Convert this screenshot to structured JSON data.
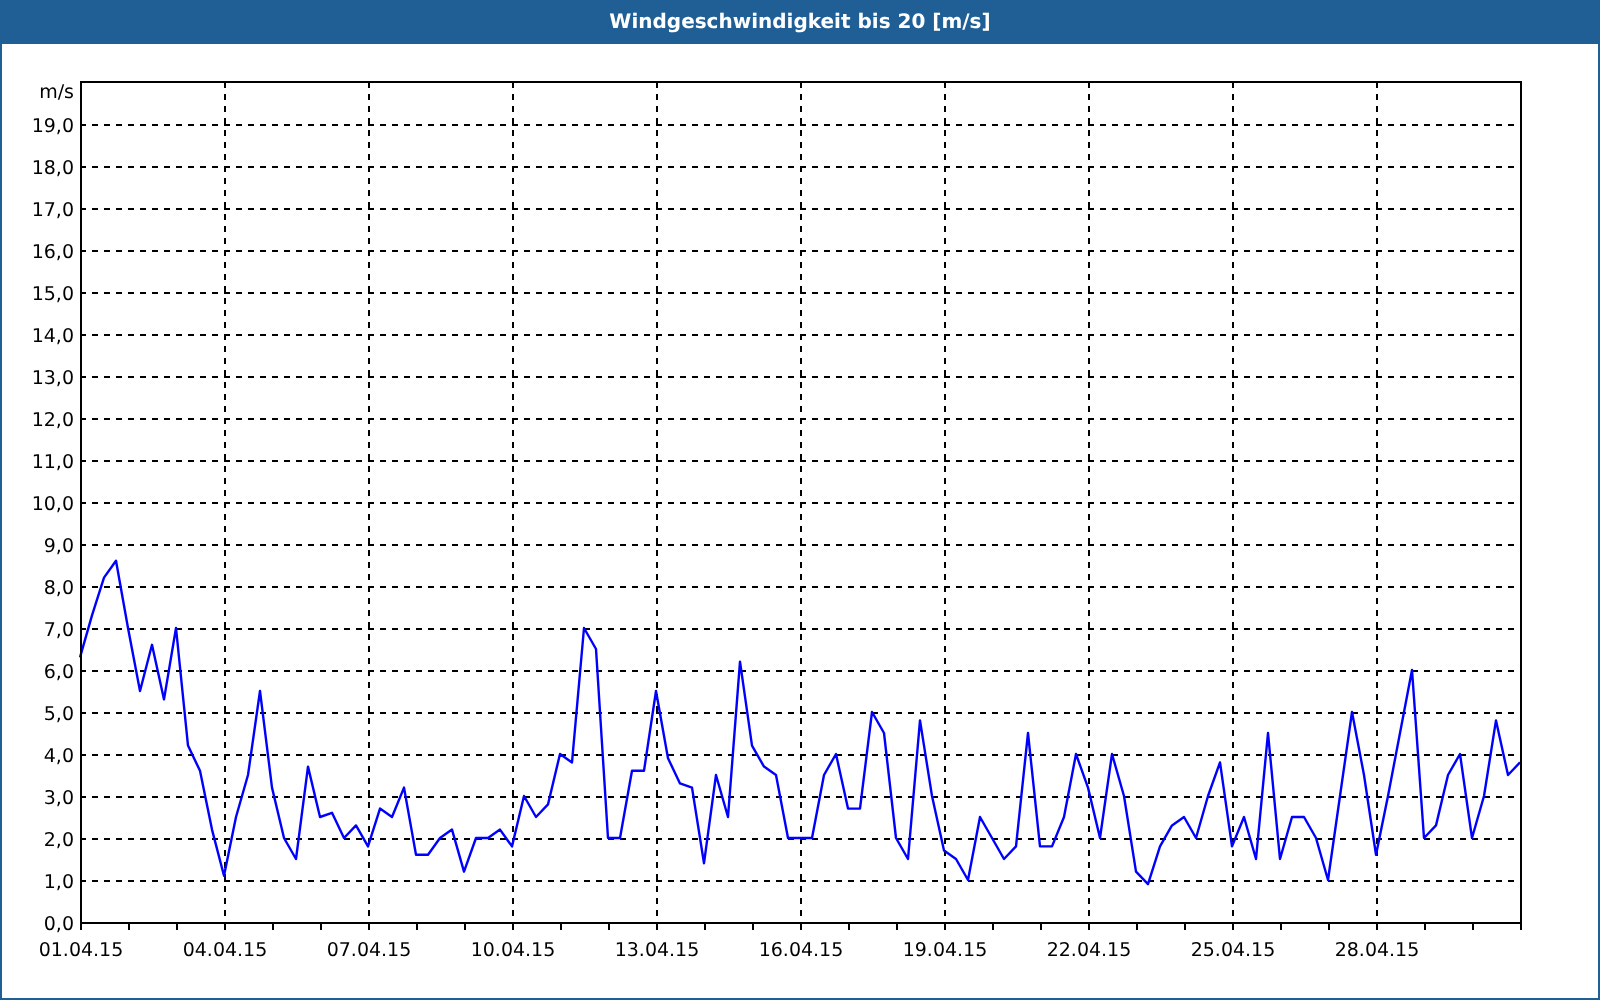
{
  "window": {
    "title": "Windgeschwindigkeit bis 20 [m/s]"
  },
  "chart": {
    "chart_data": {
      "type": "line",
      "ylabel": "m/s",
      "ylim": [
        0,
        20
      ],
      "grid": true,
      "categories": [
        "01.04.15",
        null,
        null,
        null,
        null,
        null,
        null,
        null,
        null,
        null,
        null,
        null,
        "04.04.15",
        null,
        null,
        null,
        null,
        null,
        null,
        null,
        null,
        null,
        null,
        null,
        "07.04.15",
        null,
        null,
        null,
        null,
        null,
        null,
        null,
        null,
        null,
        null,
        null,
        "10.04.15",
        null,
        null,
        null,
        null,
        null,
        null,
        null,
        null,
        null,
        null,
        null,
        "13.04.15",
        null,
        null,
        null,
        null,
        null,
        null,
        null,
        null,
        null,
        null,
        null,
        "16.04.15",
        null,
        null,
        null,
        null,
        null,
        null,
        null,
        null,
        null,
        null,
        null,
        "19.04.15",
        null,
        null,
        null,
        null,
        null,
        null,
        null,
        null,
        null,
        null,
        null,
        "22.04.15",
        null,
        null,
        null,
        null,
        null,
        null,
        null,
        null,
        null,
        null,
        null,
        "25.04.15",
        null,
        null,
        null,
        null,
        null,
        null,
        null,
        null,
        null,
        null,
        null,
        "28.04.15",
        null,
        null,
        null,
        null,
        null,
        null,
        null,
        null,
        null,
        null,
        null,
        null
      ],
      "yticks": [
        {
          "value": 0,
          "label": "0,0"
        },
        {
          "value": 1,
          "label": "1,0"
        },
        {
          "value": 2,
          "label": "2,0"
        },
        {
          "value": 3,
          "label": "3,0"
        },
        {
          "value": 4,
          "label": "4,0"
        },
        {
          "value": 5,
          "label": "5,0"
        },
        {
          "value": 6,
          "label": "6,0"
        },
        {
          "value": 7,
          "label": "7,0"
        },
        {
          "value": 8,
          "label": "8,0"
        },
        {
          "value": 9,
          "label": "9,0"
        },
        {
          "value": 10,
          "label": "10,0"
        },
        {
          "value": 11,
          "label": "11,0"
        },
        {
          "value": 12,
          "label": "12,0"
        },
        {
          "value": 13,
          "label": "13,0"
        },
        {
          "value": 14,
          "label": "14,0"
        },
        {
          "value": 15,
          "label": "15,0"
        },
        {
          "value": 16,
          "label": "16,0"
        },
        {
          "value": 17,
          "label": "17,0"
        },
        {
          "value": 18,
          "label": "18,0"
        },
        {
          "value": 19,
          "label": "19,0"
        }
      ],
      "series": [
        {
          "color": "#0000ff",
          "values": [
            6.3,
            7.3,
            8.2,
            8.6,
            7.0,
            5.5,
            6.6,
            5.3,
            7.0,
            4.2,
            3.6,
            2.2,
            1.1,
            2.5,
            3.5,
            5.5,
            3.2,
            2.0,
            1.5,
            3.7,
            2.5,
            2.6,
            2.0,
            2.3,
            1.8,
            2.7,
            2.5,
            3.2,
            1.6,
            1.6,
            2.0,
            2.2,
            1.2,
            2.0,
            2.0,
            2.2,
            1.8,
            3.0,
            2.5,
            2.8,
            4.0,
            3.8,
            7.0,
            6.5,
            2.0,
            2.0,
            3.6,
            3.6,
            5.5,
            3.9,
            3.3,
            3.2,
            1.4,
            3.5,
            2.5,
            6.2,
            4.2,
            3.7,
            3.5,
            2.0,
            2.0,
            2.0,
            3.5,
            4.0,
            2.7,
            2.7,
            5.0,
            4.5,
            2.0,
            1.5,
            4.8,
            3.0,
            1.7,
            1.5,
            1.0,
            2.5,
            2.0,
            1.5,
            1.8,
            4.5,
            1.8,
            1.8,
            2.5,
            4.0,
            3.2,
            2.0,
            4.0,
            3.0,
            1.2,
            0.9,
            1.8,
            2.3,
            2.5,
            2.0,
            3.0,
            3.8,
            1.8,
            2.5,
            1.5,
            4.5,
            1.5,
            2.5,
            2.5,
            2.0,
            1.0,
            3.0,
            5.0,
            3.5,
            1.6,
            3.0,
            4.5,
            6.0,
            2.0,
            2.3,
            3.5,
            4.0,
            2.0,
            3.0,
            4.8,
            3.5,
            3.8
          ]
        }
      ]
    }
  }
}
